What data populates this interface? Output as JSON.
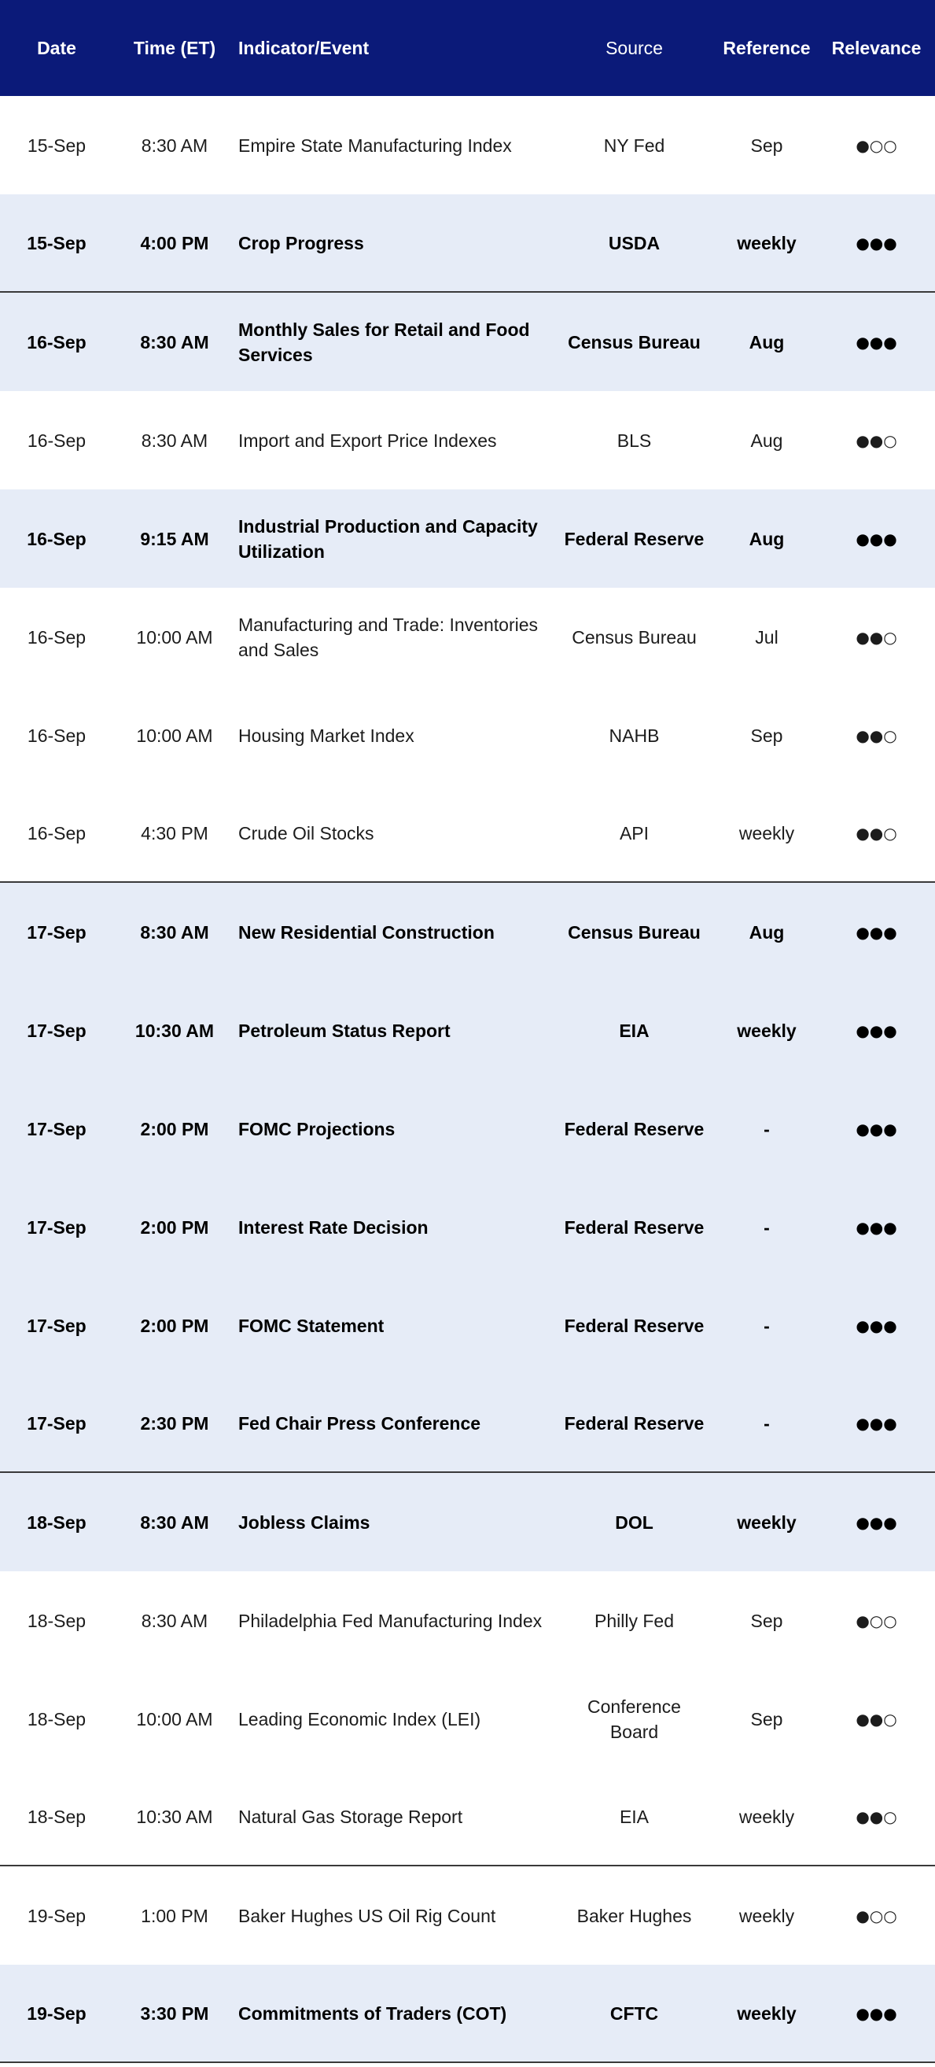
{
  "headers": {
    "date": "Date",
    "time": "Time (ET)",
    "indicator": "Indicator/Event",
    "source": "Source",
    "reference": "Reference",
    "relevance": "Relevance"
  },
  "rows": [
    {
      "date": "15-Sep",
      "time": "8:30 AM",
      "indicator": "Empire State Manufacturing Index",
      "source": "NY Fed",
      "reference": "Sep",
      "relevance": "●○○"
    },
    {
      "date": "15-Sep",
      "time": "4:00 PM",
      "indicator": "Crop Progress",
      "source": "USDA",
      "reference": "weekly",
      "relevance": "●●●"
    },
    {
      "date": "16-Sep",
      "time": "8:30 AM",
      "indicator": "Monthly Sales for Retail and Food Services",
      "source": "Census Bureau",
      "reference": "Aug",
      "relevance": "●●●"
    },
    {
      "date": "16-Sep",
      "time": "8:30 AM",
      "indicator": "Import and Export Price Indexes",
      "source": "BLS",
      "reference": "Aug",
      "relevance": "●●○"
    },
    {
      "date": "16-Sep",
      "time": "9:15 AM",
      "indicator": "Industrial Production and Capacity Utilization",
      "source": "Federal Reserve",
      "reference": "Aug",
      "relevance": "●●●"
    },
    {
      "date": "16-Sep",
      "time": "10:00 AM",
      "indicator": "Manufacturing and Trade: Inventories and Sales",
      "source": "Census Bureau",
      "reference": "Jul",
      "relevance": "●●○"
    },
    {
      "date": "16-Sep",
      "time": "10:00 AM",
      "indicator": "Housing Market Index",
      "source": "NAHB",
      "reference": "Sep",
      "relevance": "●●○"
    },
    {
      "date": "16-Sep",
      "time": "4:30 PM",
      "indicator": "Crude Oil Stocks",
      "source": "API",
      "reference": "weekly",
      "relevance": "●●○"
    },
    {
      "date": "17-Sep",
      "time": "8:30 AM",
      "indicator": "New Residential Construction",
      "source": "Census Bureau",
      "reference": "Aug",
      "relevance": "●●●"
    },
    {
      "date": "17-Sep",
      "time": "10:30 AM",
      "indicator": "Petroleum Status Report",
      "source": "EIA",
      "reference": "weekly",
      "relevance": "●●●"
    },
    {
      "date": "17-Sep",
      "time": "2:00 PM",
      "indicator": "FOMC Projections",
      "source": "Federal Reserve",
      "reference": "-",
      "relevance": "●●●"
    },
    {
      "date": "17-Sep",
      "time": "2:00 PM",
      "indicator": "Interest Rate Decision",
      "source": "Federal Reserve",
      "reference": "-",
      "relevance": "●●●"
    },
    {
      "date": "17-Sep",
      "time": "2:00 PM",
      "indicator": "FOMC Statement",
      "source": "Federal Reserve",
      "reference": "-",
      "relevance": "●●●"
    },
    {
      "date": "17-Sep",
      "time": "2:30 PM",
      "indicator": "Fed Chair Press Conference",
      "source": "Federal Reserve",
      "reference": "-",
      "relevance": "●●●"
    },
    {
      "date": "18-Sep",
      "time": "8:30 AM",
      "indicator": "Jobless Claims",
      "source": "DOL",
      "reference": "weekly",
      "relevance": "●●●"
    },
    {
      "date": "18-Sep",
      "time": "8:30 AM",
      "indicator": "Philadelphia Fed Manufacturing Index",
      "source": "Philly Fed",
      "reference": "Sep",
      "relevance": "●○○"
    },
    {
      "date": "18-Sep",
      "time": "10:00 AM",
      "indicator": "Leading Economic Index (LEI)",
      "source": "Conference Board",
      "reference": "Sep",
      "relevance": "●●○"
    },
    {
      "date": "18-Sep",
      "time": "10:30 AM",
      "indicator": "Natural Gas Storage Report",
      "source": "EIA",
      "reference": "weekly",
      "relevance": "●●○"
    },
    {
      "date": "19-Sep",
      "time": "1:00 PM",
      "indicator": "Baker Hughes US Oil Rig Count",
      "source": "Baker Hughes",
      "reference": "weekly",
      "relevance": "●○○"
    },
    {
      "date": "19-Sep",
      "time": "3:30 PM",
      "indicator": "Commitments of Traders (COT)",
      "source": "CFTC",
      "reference": "weekly",
      "relevance": "●●●"
    }
  ],
  "colors": {
    "header_bg": "#0b1a79",
    "header_text": "#ffffff",
    "highlight_row_bg": "#e6ecf7",
    "row_bg": "#ffffff",
    "separator": "#3a3a3a"
  }
}
